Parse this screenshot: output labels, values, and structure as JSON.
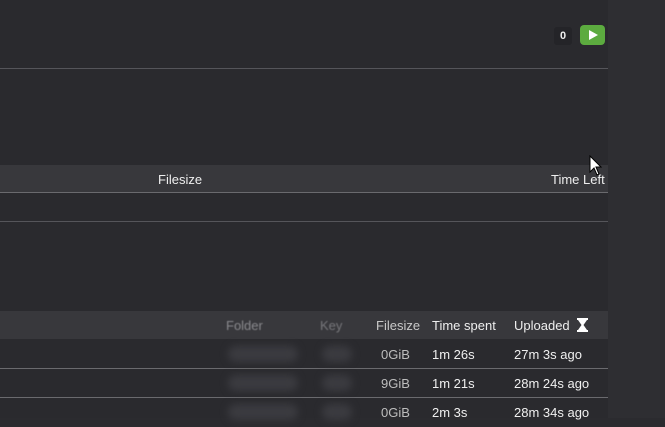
{
  "topbar": {
    "count": "0",
    "play_icon": "play-icon",
    "accent": "#5cab3f"
  },
  "table1": {
    "headers": {
      "filesize": "Filesize",
      "time_left": "Time Left"
    }
  },
  "table2": {
    "headers": {
      "folder": "Folder",
      "key": "Key",
      "filesize": "Filesize",
      "time_spent": "Time spent",
      "uploaded": "Uploaded",
      "sort_icon": "hourglass-icon"
    },
    "rows": [
      {
        "filesize": "0GiB",
        "time_spent": "1m 26s",
        "uploaded": "27m 3s ago"
      },
      {
        "filesize": "9GiB",
        "time_spent": "1m 21s",
        "uploaded": "28m 24s ago"
      },
      {
        "filesize": "0GiB",
        "time_spent": "2m 3s",
        "uploaded": "28m 34s ago"
      }
    ]
  }
}
